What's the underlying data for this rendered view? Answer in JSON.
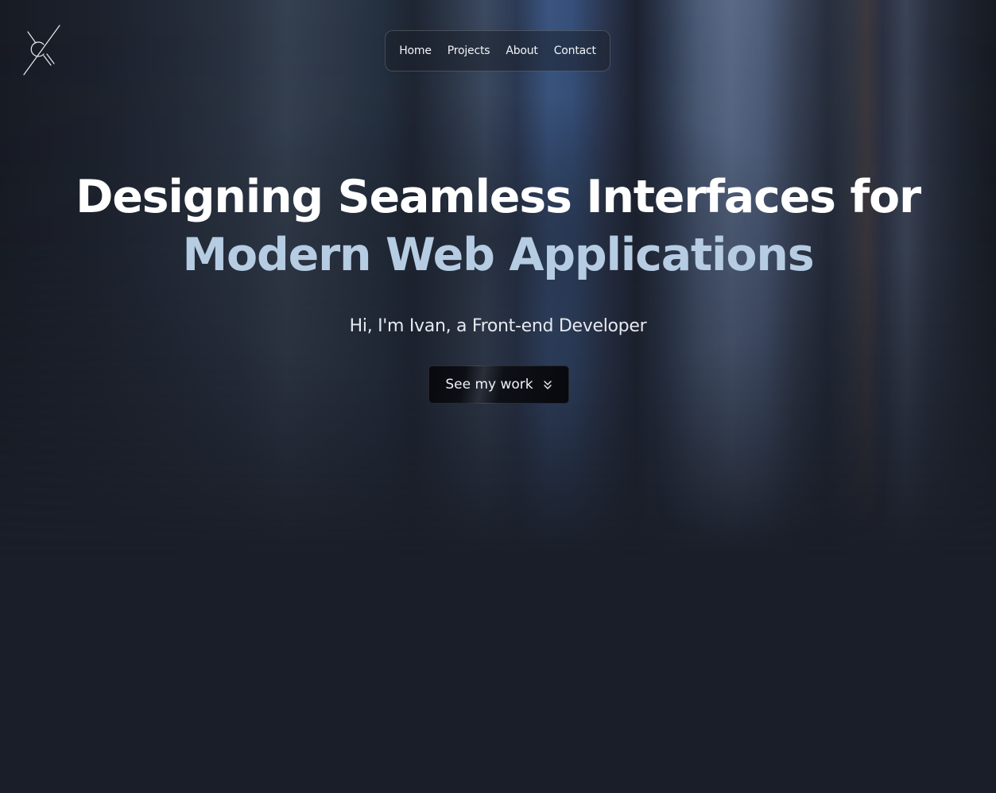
{
  "logo": {
    "icon": "x-c-monogram-icon"
  },
  "nav": {
    "items": [
      {
        "label": "Home"
      },
      {
        "label": "Projects"
      },
      {
        "label": "About"
      },
      {
        "label": "Contact"
      }
    ]
  },
  "hero": {
    "headline_line1": "Designing Seamless Interfaces for",
    "headline_line2": "Modern Web Applications",
    "subtitle": "Hi, I'm Ivan, a Front-end Developer",
    "cta_label": "See my work",
    "cta_icon": "chevrons-down-icon"
  },
  "colors": {
    "background": "#1a1e28",
    "headline_primary": "#ffffff",
    "headline_accent": "#b6cce2",
    "button_bg": "#07090e"
  }
}
